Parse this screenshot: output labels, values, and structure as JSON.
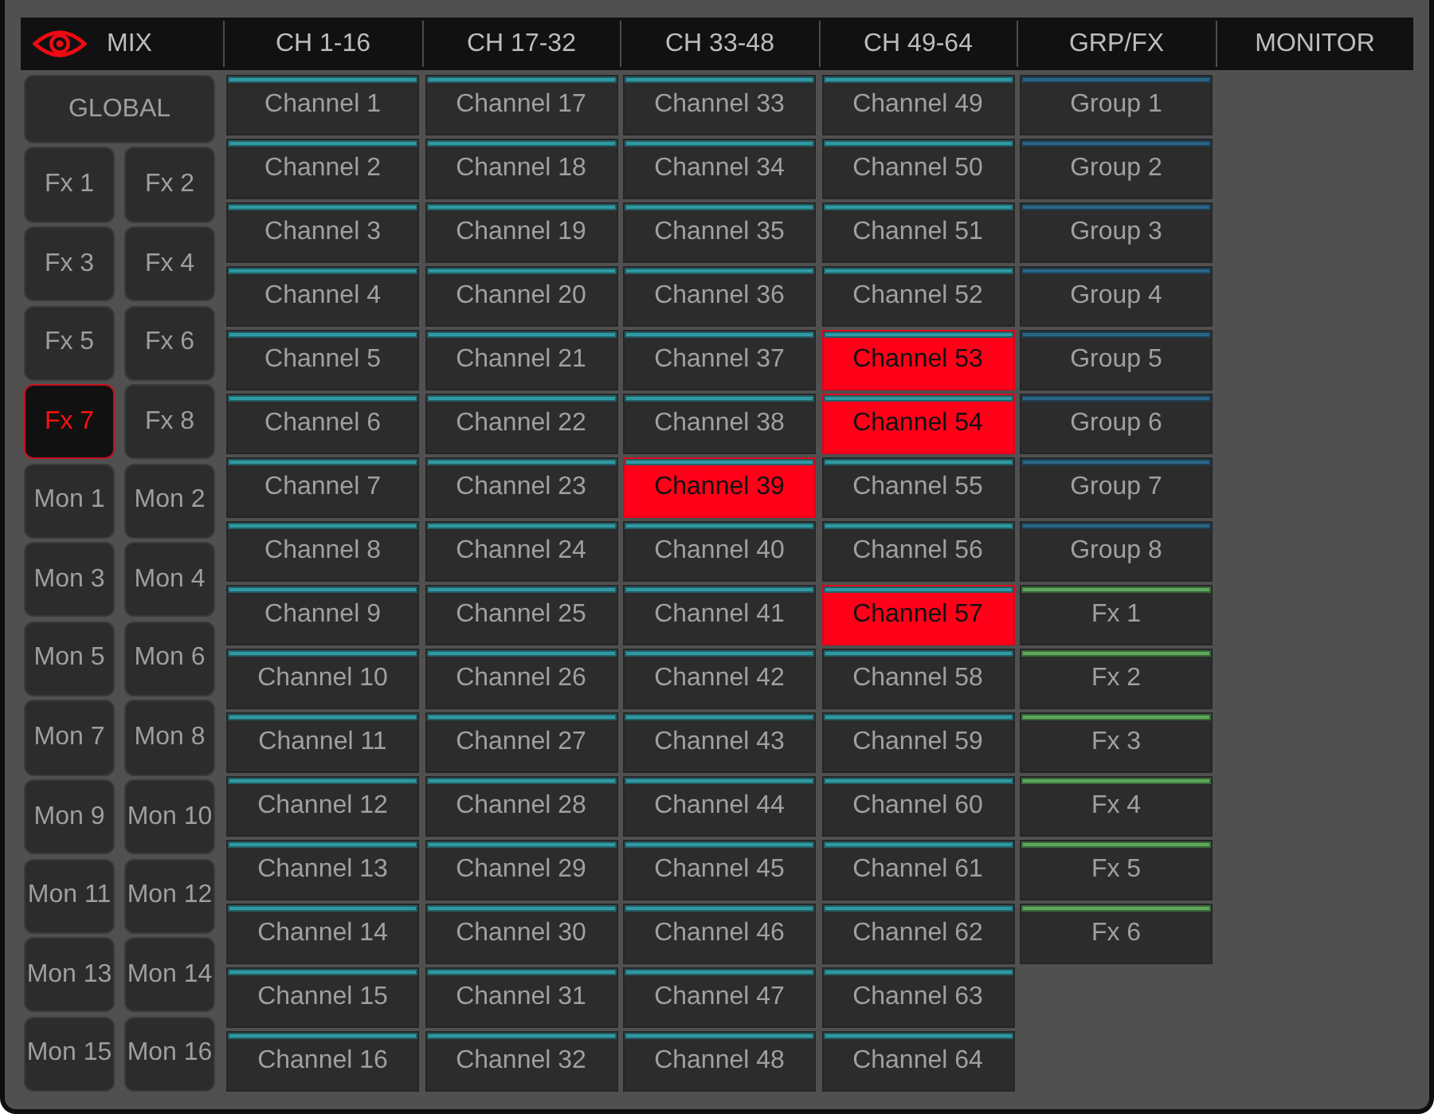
{
  "tabs": [
    {
      "label": "MIX",
      "kind": "view"
    },
    {
      "label": "CH 1-16",
      "kind": "page"
    },
    {
      "label": "CH 17-32",
      "kind": "page"
    },
    {
      "label": "CH 33-48",
      "kind": "page"
    },
    {
      "label": "CH 49-64",
      "kind": "page"
    },
    {
      "label": "GRP/FX",
      "kind": "page"
    },
    {
      "label": "MONITOR",
      "kind": "page"
    }
  ],
  "sidebar": {
    "global": {
      "label": "GLOBAL",
      "selected": false
    },
    "buttons": [
      {
        "label": "Fx 1",
        "selected": false
      },
      {
        "label": "Fx 2",
        "selected": false
      },
      {
        "label": "Fx 3",
        "selected": false
      },
      {
        "label": "Fx 4",
        "selected": false
      },
      {
        "label": "Fx 5",
        "selected": false
      },
      {
        "label": "Fx 6",
        "selected": false
      },
      {
        "label": "Fx 7",
        "selected": true
      },
      {
        "label": "Fx 8",
        "selected": false
      },
      {
        "label": "Mon 1",
        "selected": false
      },
      {
        "label": "Mon 2",
        "selected": false
      },
      {
        "label": "Mon 3",
        "selected": false
      },
      {
        "label": "Mon 4",
        "selected": false
      },
      {
        "label": "Mon 5",
        "selected": false
      },
      {
        "label": "Mon 6",
        "selected": false
      },
      {
        "label": "Mon 7",
        "selected": false
      },
      {
        "label": "Mon 8",
        "selected": false
      },
      {
        "label": "Mon 9",
        "selected": false
      },
      {
        "label": "Mon 10",
        "selected": false
      },
      {
        "label": "Mon 11",
        "selected": false
      },
      {
        "label": "Mon 12",
        "selected": false
      },
      {
        "label": "Mon 13",
        "selected": false
      },
      {
        "label": "Mon 14",
        "selected": false
      },
      {
        "label": "Mon 15",
        "selected": false
      },
      {
        "label": "Mon 16",
        "selected": false
      }
    ]
  },
  "columns": [
    {
      "cells": [
        {
          "label": "Channel 1",
          "kind": "channel",
          "selected": false
        },
        {
          "label": "Channel 2",
          "kind": "channel",
          "selected": false
        },
        {
          "label": "Channel 3",
          "kind": "channel",
          "selected": false
        },
        {
          "label": "Channel 4",
          "kind": "channel",
          "selected": false
        },
        {
          "label": "Channel 5",
          "kind": "channel",
          "selected": false
        },
        {
          "label": "Channel 6",
          "kind": "channel",
          "selected": false
        },
        {
          "label": "Channel 7",
          "kind": "channel",
          "selected": false
        },
        {
          "label": "Channel 8",
          "kind": "channel",
          "selected": false
        },
        {
          "label": "Channel 9",
          "kind": "channel",
          "selected": false
        },
        {
          "label": "Channel 10",
          "kind": "channel",
          "selected": false
        },
        {
          "label": "Channel 11",
          "kind": "channel",
          "selected": false
        },
        {
          "label": "Channel 12",
          "kind": "channel",
          "selected": false
        },
        {
          "label": "Channel 13",
          "kind": "channel",
          "selected": false
        },
        {
          "label": "Channel 14",
          "kind": "channel",
          "selected": false
        },
        {
          "label": "Channel 15",
          "kind": "channel",
          "selected": false
        },
        {
          "label": "Channel 16",
          "kind": "channel",
          "selected": false
        }
      ]
    },
    {
      "cells": [
        {
          "label": "Channel 17",
          "kind": "channel",
          "selected": false
        },
        {
          "label": "Channel 18",
          "kind": "channel",
          "selected": false
        },
        {
          "label": "Channel 19",
          "kind": "channel",
          "selected": false
        },
        {
          "label": "Channel 20",
          "kind": "channel",
          "selected": false
        },
        {
          "label": "Channel 21",
          "kind": "channel",
          "selected": false
        },
        {
          "label": "Channel 22",
          "kind": "channel",
          "selected": false
        },
        {
          "label": "Channel 23",
          "kind": "channel",
          "selected": false
        },
        {
          "label": "Channel 24",
          "kind": "channel",
          "selected": false
        },
        {
          "label": "Channel 25",
          "kind": "channel",
          "selected": false
        },
        {
          "label": "Channel 26",
          "kind": "channel",
          "selected": false
        },
        {
          "label": "Channel 27",
          "kind": "channel",
          "selected": false
        },
        {
          "label": "Channel 28",
          "kind": "channel",
          "selected": false
        },
        {
          "label": "Channel 29",
          "kind": "channel",
          "selected": false
        },
        {
          "label": "Channel 30",
          "kind": "channel",
          "selected": false
        },
        {
          "label": "Channel 31",
          "kind": "channel",
          "selected": false
        },
        {
          "label": "Channel 32",
          "kind": "channel",
          "selected": false
        }
      ]
    },
    {
      "cells": [
        {
          "label": "Channel 33",
          "kind": "channel",
          "selected": false
        },
        {
          "label": "Channel 34",
          "kind": "channel",
          "selected": false
        },
        {
          "label": "Channel 35",
          "kind": "channel",
          "selected": false
        },
        {
          "label": "Channel 36",
          "kind": "channel",
          "selected": false
        },
        {
          "label": "Channel 37",
          "kind": "channel",
          "selected": false
        },
        {
          "label": "Channel 38",
          "kind": "channel",
          "selected": false
        },
        {
          "label": "Channel 39",
          "kind": "channel",
          "selected": true
        },
        {
          "label": "Channel 40",
          "kind": "channel",
          "selected": false
        },
        {
          "label": "Channel 41",
          "kind": "channel",
          "selected": false
        },
        {
          "label": "Channel 42",
          "kind": "channel",
          "selected": false
        },
        {
          "label": "Channel 43",
          "kind": "channel",
          "selected": false
        },
        {
          "label": "Channel 44",
          "kind": "channel",
          "selected": false
        },
        {
          "label": "Channel 45",
          "kind": "channel",
          "selected": false
        },
        {
          "label": "Channel 46",
          "kind": "channel",
          "selected": false
        },
        {
          "label": "Channel 47",
          "kind": "channel",
          "selected": false
        },
        {
          "label": "Channel 48",
          "kind": "channel",
          "selected": false
        }
      ]
    },
    {
      "cells": [
        {
          "label": "Channel 49",
          "kind": "channel",
          "selected": false
        },
        {
          "label": "Channel 50",
          "kind": "channel",
          "selected": false
        },
        {
          "label": "Channel 51",
          "kind": "channel",
          "selected": false
        },
        {
          "label": "Channel 52",
          "kind": "channel",
          "selected": false
        },
        {
          "label": "Channel 53",
          "kind": "channel",
          "selected": true
        },
        {
          "label": "Channel 54",
          "kind": "channel",
          "selected": true
        },
        {
          "label": "Channel 55",
          "kind": "channel",
          "selected": false
        },
        {
          "label": "Channel 56",
          "kind": "channel",
          "selected": false
        },
        {
          "label": "Channel 57",
          "kind": "channel",
          "selected": true
        },
        {
          "label": "Channel 58",
          "kind": "channel",
          "selected": false
        },
        {
          "label": "Channel 59",
          "kind": "channel",
          "selected": false
        },
        {
          "label": "Channel 60",
          "kind": "channel",
          "selected": false
        },
        {
          "label": "Channel 61",
          "kind": "channel",
          "selected": false
        },
        {
          "label": "Channel 62",
          "kind": "channel",
          "selected": false
        },
        {
          "label": "Channel 63",
          "kind": "channel",
          "selected": false
        },
        {
          "label": "Channel 64",
          "kind": "channel",
          "selected": false
        }
      ]
    },
    {
      "cells": [
        {
          "label": "Group 1",
          "kind": "group",
          "selected": false
        },
        {
          "label": "Group 2",
          "kind": "group",
          "selected": false
        },
        {
          "label": "Group 3",
          "kind": "group",
          "selected": false
        },
        {
          "label": "Group 4",
          "kind": "group",
          "selected": false
        },
        {
          "label": "Group 5",
          "kind": "group",
          "selected": false
        },
        {
          "label": "Group 6",
          "kind": "group",
          "selected": false
        },
        {
          "label": "Group 7",
          "kind": "group",
          "selected": false
        },
        {
          "label": "Group 8",
          "kind": "group",
          "selected": false
        },
        {
          "label": "Fx 1",
          "kind": "fx",
          "selected": false
        },
        {
          "label": "Fx 2",
          "kind": "fx",
          "selected": false
        },
        {
          "label": "Fx 3",
          "kind": "fx",
          "selected": false
        },
        {
          "label": "Fx 4",
          "kind": "fx",
          "selected": false
        },
        {
          "label": "Fx 5",
          "kind": "fx",
          "selected": false
        },
        {
          "label": "Fx 6",
          "kind": "fx",
          "selected": false
        }
      ]
    }
  ]
}
